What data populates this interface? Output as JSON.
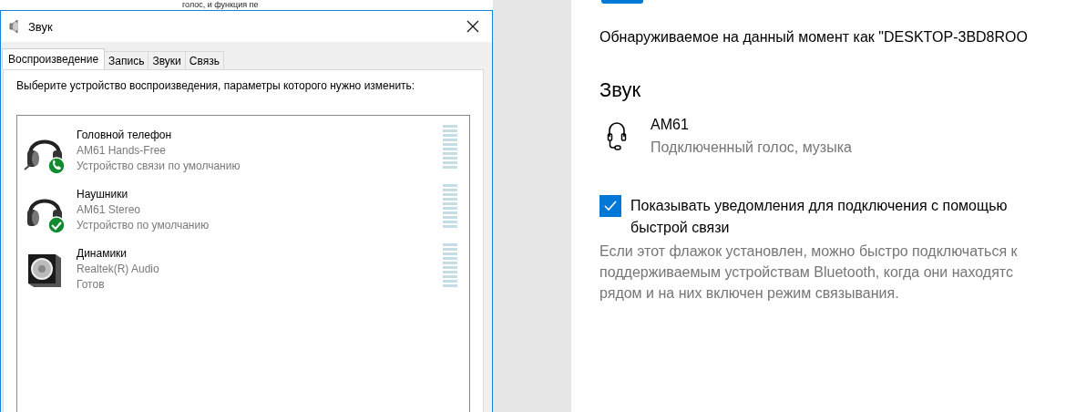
{
  "background_text": "голос, и функция пе",
  "dialog": {
    "title": "Звук",
    "tabs": [
      {
        "label": "Воспроизведение",
        "selected": true
      },
      {
        "label": "Запись",
        "selected": false
      },
      {
        "label": "Звуки",
        "selected": false
      },
      {
        "label": "Связь",
        "selected": false
      }
    ],
    "instruction": "Выберите устройство воспроизведения, параметры которого нужно изменить:",
    "devices": [
      {
        "kind": "headset",
        "comms_default": true,
        "default": false,
        "name": "Головной телефон",
        "model": "AM61 Hands-Free",
        "status": "Устройство связи по умолчанию"
      },
      {
        "kind": "headset",
        "comms_default": false,
        "default": true,
        "name": "Наушники",
        "model": "AM61 Stereo",
        "status": "Устройство по умолчанию"
      },
      {
        "kind": "speaker",
        "comms_default": false,
        "default": false,
        "name": "Динамики",
        "model": "Realtek(R) Audio",
        "status": "Готов"
      }
    ]
  },
  "settings": {
    "bluetooth_toggle": {
      "on": true
    },
    "discoverable": "Обнаруживаемое на данный момент как \"DESKTOP-3BD8ROO",
    "section_title": "Звук",
    "device": {
      "name": "AM61",
      "status": "Подключенный голос, музыка"
    },
    "swift_pair": {
      "label": "Показывать уведомления для подключения с помощью быстрой связи",
      "checked": true,
      "description": [
        "Если этот флажок установлен, можно быстро подключаться к",
        "поддерживаемым устройствам Bluetooth, когда они находятс",
        "рядом и на них включен режим связывания."
      ]
    }
  }
}
